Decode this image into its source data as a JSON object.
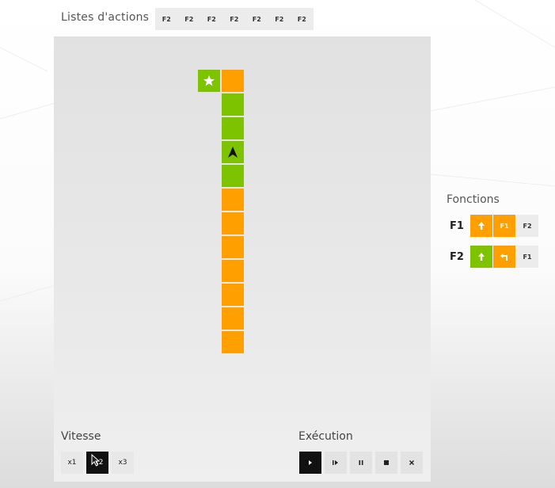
{
  "actions": {
    "title": "Listes d'actions",
    "items": [
      "F2",
      "F2",
      "F2",
      "F2",
      "F2",
      "F2",
      "F2"
    ]
  },
  "board": {
    "cells": [
      {
        "col": 0,
        "row": 0,
        "color": "green",
        "content": "star-icon"
      },
      {
        "col": 1,
        "row": 0,
        "color": "orange",
        "content": ""
      },
      {
        "col": 1,
        "row": 1,
        "color": "green",
        "content": ""
      },
      {
        "col": 1,
        "row": 2,
        "color": "green",
        "content": ""
      },
      {
        "col": 1,
        "row": 3,
        "color": "green",
        "content": "robot-arrow-up-icon"
      },
      {
        "col": 1,
        "row": 4,
        "color": "green",
        "content": ""
      },
      {
        "col": 1,
        "row": 5,
        "color": "orange",
        "content": ""
      },
      {
        "col": 1,
        "row": 6,
        "color": "orange",
        "content": ""
      },
      {
        "col": 1,
        "row": 7,
        "color": "orange",
        "content": ""
      },
      {
        "col": 1,
        "row": 8,
        "color": "orange",
        "content": ""
      },
      {
        "col": 1,
        "row": 9,
        "color": "orange",
        "content": ""
      },
      {
        "col": 1,
        "row": 10,
        "color": "orange",
        "content": ""
      },
      {
        "col": 1,
        "row": 11,
        "color": "orange",
        "content": ""
      }
    ]
  },
  "speed": {
    "label": "Vitesse",
    "options": [
      "x1",
      "x2",
      "x3"
    ],
    "selected": "x2"
  },
  "execution": {
    "label": "Exécution",
    "buttons": [
      "play-icon",
      "step-icon",
      "pause-icon",
      "stop-icon",
      "reset-icon"
    ]
  },
  "functions": {
    "title": "Fonctions",
    "rows": [
      {
        "name": "F1",
        "slots": [
          {
            "color": "orange",
            "icon": "arrow-up-icon",
            "text": ""
          },
          {
            "color": "orange",
            "icon": "",
            "text": "F1"
          },
          {
            "color": "gray",
            "icon": "",
            "text": "F2"
          }
        ]
      },
      {
        "name": "F2",
        "slots": [
          {
            "color": "green",
            "icon": "arrow-up-icon",
            "text": ""
          },
          {
            "color": "orange",
            "icon": "turn-left-icon",
            "text": ""
          },
          {
            "color": "gray",
            "icon": "",
            "text": "F1"
          }
        ]
      }
    ]
  },
  "colors": {
    "orange": "#ff9f00",
    "green": "#7ec300",
    "dark": "#111111"
  }
}
